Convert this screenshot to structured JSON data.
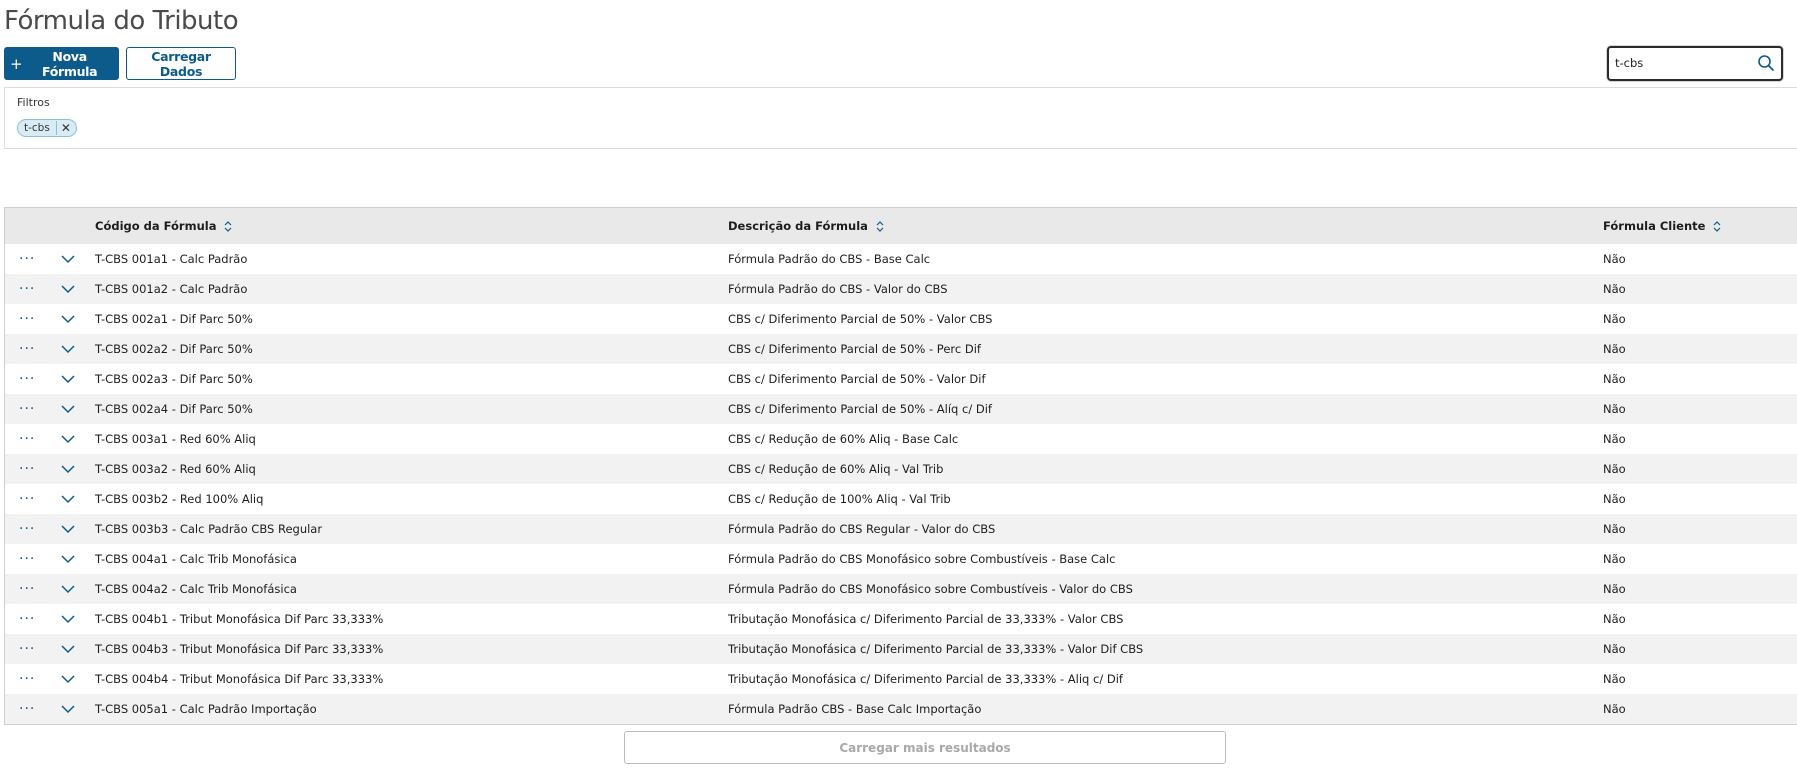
{
  "page": {
    "title": "Fórmula do Tributo"
  },
  "toolbar": {
    "new_label": "Nova Fórmula",
    "load_label": "Carregar Dados"
  },
  "search": {
    "value": "t-cbs"
  },
  "filters": {
    "label": "Filtros",
    "chips": [
      "t-cbs"
    ]
  },
  "table": {
    "columns": [
      "Código da Fórmula",
      "Descrição da Fórmula",
      "Fórmula Cliente"
    ],
    "rows": [
      {
        "code": "T-CBS 001a1 - Calc Padrão",
        "desc": "Fórmula Padrão do CBS - Base Calc",
        "client": "Não"
      },
      {
        "code": "T-CBS 001a2 - Calc Padrão",
        "desc": "Fórmula Padrão do CBS - Valor do CBS",
        "client": "Não"
      },
      {
        "code": "T-CBS 002a1 - Dif Parc 50%",
        "desc": "CBS c/ Diferimento Parcial de 50% - Valor CBS",
        "client": "Não"
      },
      {
        "code": "T-CBS 002a2 - Dif Parc 50%",
        "desc": "CBS c/ Diferimento Parcial de 50% - Perc Dif",
        "client": "Não"
      },
      {
        "code": "T-CBS 002a3 - Dif Parc 50%",
        "desc": "CBS c/ Diferimento Parcial de 50% - Valor Dif",
        "client": "Não"
      },
      {
        "code": "T-CBS 002a4 - Dif Parc 50%",
        "desc": "CBS c/ Diferimento Parcial de 50% - Alíq c/ Dif",
        "client": "Não"
      },
      {
        "code": "T-CBS 003a1 - Red 60% Aliq",
        "desc": "CBS c/ Redução de 60% Aliq - Base Calc",
        "client": "Não"
      },
      {
        "code": "T-CBS 003a2 - Red 60% Aliq",
        "desc": "CBS c/ Redução de 60% Aliq - Val Trib",
        "client": "Não"
      },
      {
        "code": "T-CBS 003b2 - Red 100% Aliq",
        "desc": "CBS c/ Redução de 100% Aliq - Val Trib",
        "client": "Não"
      },
      {
        "code": "T-CBS 003b3 - Calc Padrão CBS Regular",
        "desc": "Fórmula Padrão do CBS Regular - Valor do CBS",
        "client": "Não"
      },
      {
        "code": "T-CBS 004a1 - Calc Trib Monofásica",
        "desc": "Fórmula Padrão do CBS Monofásico sobre Combustíveis - Base Calc",
        "client": "Não"
      },
      {
        "code": "T-CBS 004a2 - Calc Trib Monofásica",
        "desc": "Fórmula Padrão do CBS Monofásico sobre Combustíveis - Valor do CBS",
        "client": "Não"
      },
      {
        "code": "T-CBS 004b1 - Tribut Monofásica Dif Parc 33,333%",
        "desc": "Tributação Monofásica c/ Diferimento Parcial de 33,333% - Valor CBS",
        "client": "Não"
      },
      {
        "code": "T-CBS 004b3 - Tribut Monofásica Dif Parc 33,333%",
        "desc": "Tributação Monofásica c/ Diferimento Parcial de 33,333% - Valor Dif CBS",
        "client": "Não"
      },
      {
        "code": "T-CBS 004b4 - Tribut Monofásica Dif Parc 33,333%",
        "desc": "Tributação Monofásica c/ Diferimento Parcial de 33,333% - Aliq c/ Dif",
        "client": "Não"
      },
      {
        "code": "T-CBS 005a1 - Calc Padrão Importação",
        "desc": "Fórmula Padrão CBS - Base Calc Importação",
        "client": "Não"
      }
    ]
  },
  "footer": {
    "load_more_label": "Carregar mais resultados"
  },
  "icons": {
    "search": "search-icon",
    "sort": "sort-icon",
    "row_menu": "more-horizontal-icon",
    "expand": "chevron-down-icon",
    "chip_remove": "close-icon",
    "add": "plus-icon"
  },
  "colors": {
    "primary": "#0c5b8a",
    "chip_bg": "#d9ecf5",
    "header_bg": "#e9e9e9",
    "row_alt": "#f2f2f2"
  }
}
